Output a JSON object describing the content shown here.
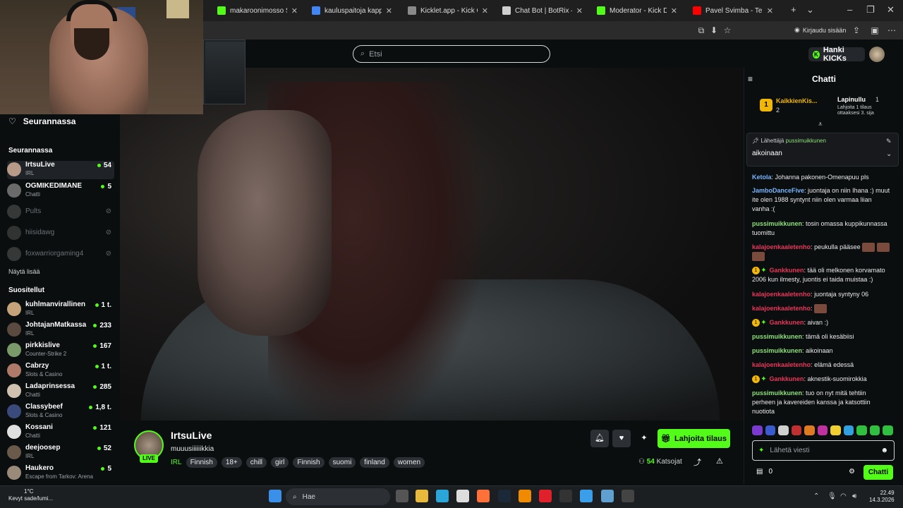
{
  "browser": {
    "tabs": [
      {
        "label": "makaroonimosso Stream -",
        "color": "#53fc18"
      },
      {
        "label": "kauluspaitoja kappale - Go",
        "color": "#4285f4"
      },
      {
        "label": "Kicklet.app - Kick Chatbot",
        "color": "#8a8a8a"
      },
      {
        "label": "Chat Bot | BotRix — Cloud",
        "color": "#cfcfcf"
      },
      {
        "label": "Moderator - Kick Dashboa",
        "color": "#53fc18"
      },
      {
        "label": "Pavel Svimba - Teknikal Pro",
        "color": "#ff0000"
      }
    ],
    "signin_label": "Kirjaudu sisään"
  },
  "header": {
    "search_placeholder": "Etsi",
    "kicks_label": "Hanki KICKs"
  },
  "sidebar": {
    "following_header": "Seurannassa",
    "following_section": "Seurannassa",
    "following": [
      {
        "name": "IrtsuLive",
        "category": "IRL",
        "viewers": "54",
        "live": true,
        "avatar": "#b89a88"
      },
      {
        "name": "OGMIKEDIMANE",
        "category": "Chatti",
        "viewers": "5",
        "live": true,
        "avatar": "#6a6a6a"
      },
      {
        "name": "Pults",
        "category": "",
        "viewers": "",
        "live": false,
        "avatar": "#888"
      },
      {
        "name": "hiisidawg",
        "category": "",
        "viewers": "",
        "live": false,
        "avatar": "#777"
      },
      {
        "name": "foxwarriorgaming4",
        "category": "",
        "viewers": "",
        "live": false,
        "avatar": "#888"
      }
    ],
    "show_more": "Näytä lisää",
    "recommended_section": "Suositellut",
    "recommended": [
      {
        "name": "kuhlmanvirallinen",
        "category": "IRL",
        "viewers": "1 t.",
        "avatar": "#c4a27a"
      },
      {
        "name": "JohtajanMatkassa",
        "category": "IRL",
        "viewers": "233",
        "avatar": "#5a4a40"
      },
      {
        "name": "pirkkislive",
        "category": "Counter-Strike 2",
        "viewers": "167",
        "avatar": "#7a9a6a"
      },
      {
        "name": "Cabrzy",
        "category": "Slots & Casino",
        "viewers": "1 t.",
        "avatar": "#b07a6a"
      },
      {
        "name": "Ladaprinsessa",
        "category": "Chatti",
        "viewers": "285",
        "avatar": "#d0c0b0"
      },
      {
        "name": "Classybeef",
        "category": "Slots & Casino",
        "viewers": "1,8 t.",
        "avatar": "#3a4a7a"
      },
      {
        "name": "Kossani",
        "category": "Chatti",
        "viewers": "121",
        "avatar": "#e0e0e0"
      },
      {
        "name": "deejoosep",
        "category": "IRL",
        "viewers": "52",
        "avatar": "#6a5a4a"
      },
      {
        "name": "Haukero",
        "category": "Escape from Tarkov: Arena",
        "viewers": "5",
        "avatar": "#9a8a7a"
      }
    ]
  },
  "stream": {
    "channel": "IrtsuLive",
    "title": "muuusiiiiiikkia",
    "live_badge": "LIVE",
    "category": "IRL",
    "tags": [
      "Finnish",
      "18+",
      "chill",
      "girl",
      "Finnish",
      "suomi",
      "finland",
      "women"
    ],
    "gift_label": "Lahjoita tilaus",
    "viewers_count": "54",
    "viewers_label": "Katsojat"
  },
  "chat": {
    "title": "Chatti",
    "leaderboard": {
      "first_rank": "1",
      "first_name": "KaikkienKis...",
      "first_count": "2",
      "second_name": "Lapinullu",
      "second_count": "1",
      "second_note": "Lahjoita 1 tilaus ottaaksesi 3. sija"
    },
    "pinned_by_prefix": "Lähettäjä",
    "pinned_by": "pussimuikkunen",
    "pinned_text": "aikoinaan",
    "messages": [
      {
        "user": "Ketola",
        "text": "Johanna pakonen-Omenapuu pls",
        "color": "ub",
        "badges": false,
        "emotes": 0
      },
      {
        "user": "JamboDanceFive",
        "text": "juontaja on niin Ihana :) muut ite olen 1988 syntynt niin olen varmaa liian vanha :(",
        "color": "ub",
        "badges": false,
        "emotes": 0
      },
      {
        "user": "pussimuikkunen",
        "text": "tosin omassa kuppikunnassa tuomittu",
        "color": "ug",
        "badges": false,
        "emotes": 0
      },
      {
        "user": "kalajoenkaaletenho",
        "text": "peukulla pääsee",
        "color": "ur",
        "badges": false,
        "emotes": 3
      },
      {
        "user": "Gankkunen",
        "text": "tää oli melkonen korvamato 2006 kun ilmesty, juontis ei taida muistaa :)",
        "color": "ur",
        "badges": true,
        "emotes": 0
      },
      {
        "user": "kalajoenkaaletenho",
        "text": "juontaja syntyny 06",
        "color": "ur",
        "badges": false,
        "emotes": 0
      },
      {
        "user": "kalajoenkaaletenho",
        "text": "",
        "color": "ur",
        "badges": false,
        "emotes": 1
      },
      {
        "user": "Gankkunen",
        "text": "aivan :)",
        "color": "ur",
        "badges": true,
        "emotes": 0
      },
      {
        "user": "pussimuikkunen",
        "text": "tämä oli kesäbiisi",
        "color": "ug",
        "badges": false,
        "emotes": 0
      },
      {
        "user": "pussimuikkunen",
        "text": "aikoinaan",
        "color": "ug",
        "badges": false,
        "emotes": 0
      },
      {
        "user": "kalajoenkaaletenho",
        "text": "elämä edessä",
        "color": "ur",
        "badges": false,
        "emotes": 0
      },
      {
        "user": "Gankkunen",
        "text": "aknestik-suomirokkia",
        "color": "ur",
        "badges": true,
        "emotes": 0
      },
      {
        "user": "pussimuikkunen",
        "text": "tuo on nyt mitä tehtiin perheen ja kavereiden kanssa ja katsottiin nuotiota",
        "color": "ug",
        "badges": false,
        "emotes": 0
      }
    ],
    "input_placeholder": "Lähetä viesti",
    "points": "0",
    "send_label": "Chatti"
  },
  "taskbar": {
    "weather_temp": "1°C",
    "weather_desc": "Kevyt sade/lumi...",
    "search_label": "Hae",
    "time": "22.49",
    "date": "14.3.2026"
  }
}
